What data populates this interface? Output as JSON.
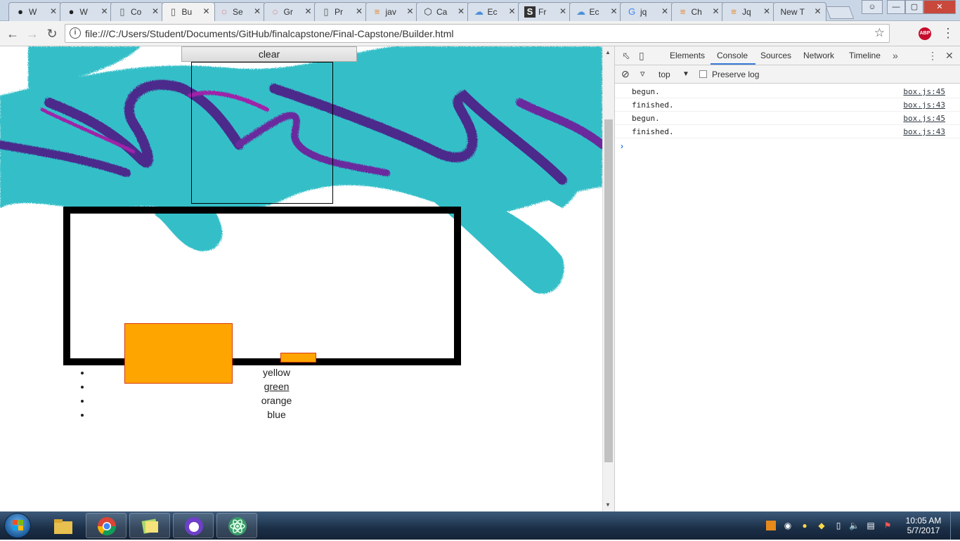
{
  "browser": {
    "tabs": [
      {
        "title": "W",
        "icon": "github-icon"
      },
      {
        "title": "W",
        "icon": "github-icon"
      },
      {
        "title": "Co",
        "icon": "page-icon"
      },
      {
        "title": "Bu",
        "icon": "page-icon",
        "active": true
      },
      {
        "title": "Se",
        "icon": "opera-icon"
      },
      {
        "title": "Gr",
        "icon": "opera-icon"
      },
      {
        "title": "Pr",
        "icon": "page-icon"
      },
      {
        "title": "jav",
        "icon": "stackoverflow-icon"
      },
      {
        "title": "Ca",
        "icon": "codepen-icon"
      },
      {
        "title": "Ec",
        "icon": "cloud-icon"
      },
      {
        "title": "Fr",
        "icon": "s-icon"
      },
      {
        "title": "Ec",
        "icon": "cloud-icon"
      },
      {
        "title": "jq",
        "icon": "google-icon"
      },
      {
        "title": "Ch",
        "icon": "stackoverflow-icon"
      },
      {
        "title": "Jq",
        "icon": "stackoverflow-icon"
      },
      {
        "title": "New T",
        "icon": ""
      }
    ],
    "url": "file:///C:/Users/Student/Documents/GitHub/finalcapstone/Final-Capstone/Builder.html",
    "extensions": [
      {
        "label": "ABP",
        "color": "#c70d2c"
      },
      {
        "label": "",
        "color": "#e0452b"
      }
    ]
  },
  "page": {
    "clear_label": "clear",
    "colors": [
      "yellow",
      "green",
      "orange",
      "blue"
    ],
    "box_fill": "#ffa500",
    "box_border": "#d83a00"
  },
  "devtools": {
    "tabs": [
      "Elements",
      "Console",
      "Sources",
      "Network",
      "Timeline"
    ],
    "active_tab": "Console",
    "context": "top",
    "preserve_log": "Preserve log",
    "logs": [
      {
        "message": "begun.",
        "source": "box.js:45"
      },
      {
        "message": "finished.",
        "source": "box.js:43"
      },
      {
        "message": "begun.",
        "source": "box.js:45"
      },
      {
        "message": "finished.",
        "source": "box.js:43"
      }
    ]
  },
  "taskbar": {
    "time": "10:05 AM",
    "date": "5/7/2017"
  }
}
